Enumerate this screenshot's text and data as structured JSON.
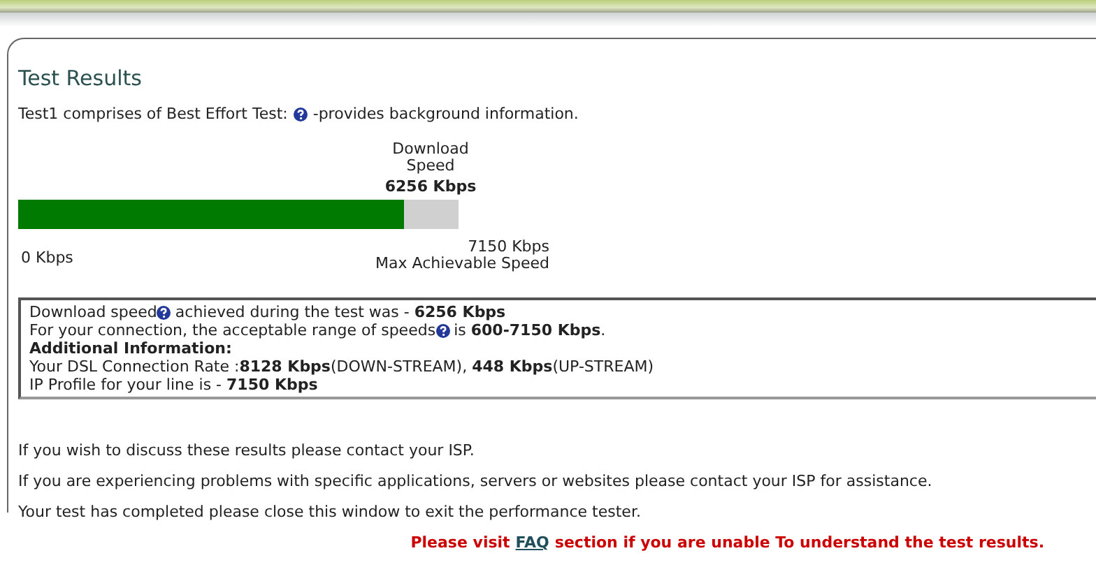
{
  "title": "Test Results",
  "intro": {
    "before": "Test1 comprises of Best Effort Test:",
    "help": true,
    "after": "-provides background information."
  },
  "meter": {
    "label_lines": [
      "Download",
      "Speed"
    ],
    "value": "6256 Kbps",
    "level": 0.875,
    "min": "0 Kbps",
    "max": "7150 Kbps",
    "max_caption": "Max Achievable Speed"
  },
  "details": [
    {
      "kind": "line",
      "before": "Download speed",
      "help": true,
      "after": "achieved during the test was - **6256 Kbps**"
    },
    {
      "kind": "line",
      "before": "For your connection, the acceptable range of speeds",
      "help": true,
      "after": "is **600-7150 Kbps**."
    },
    {
      "kind": "heading",
      "before": "Additional Information:",
      "help": false
    },
    {
      "kind": "line",
      "before": "Your DSL Connection Rate :**8128 Kbps**(DOWN-STREAM), **448 Kbps**(UP-STREAM)",
      "help": false
    },
    {
      "kind": "line",
      "before": "IP Profile for your line is - **7150 Kbps**",
      "help": false
    }
  ],
  "notes": [
    "If you wish to discuss these results please contact your ISP.",
    "If you are experiencing problems with specific applications, servers or websites please contact your ISP for assistance.",
    "Your test has completed please close this window to exit the performance tester."
  ],
  "notice": {
    "before": "Please visit",
    "link": "FAQ",
    "after": "section if you are unable To understand the test results."
  }
}
